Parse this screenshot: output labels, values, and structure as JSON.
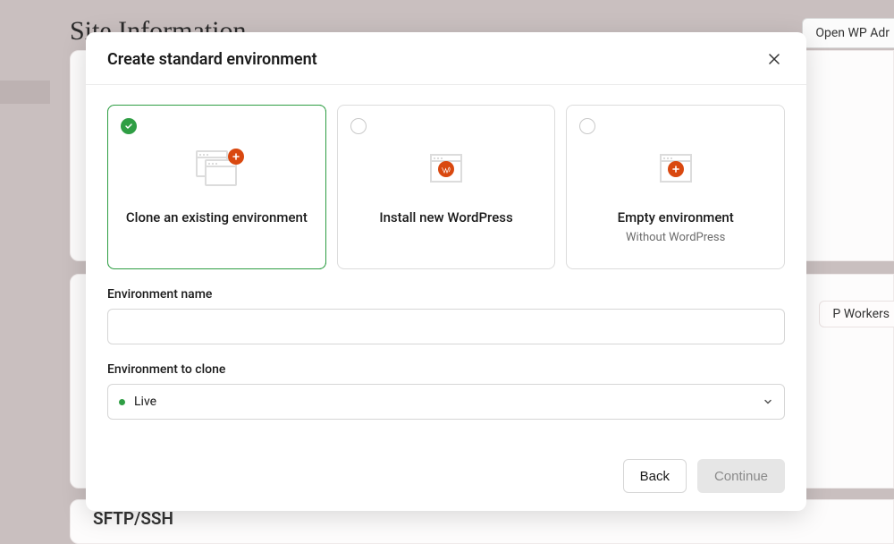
{
  "background": {
    "page_title": "Site Information",
    "wp_admin_button": "Open WP Adr",
    "workers_pill": "P Workers",
    "sftp_title": "SFTP/SSH"
  },
  "modal": {
    "title": "Create standard environment",
    "options": {
      "clone": {
        "title": "Clone an existing environment"
      },
      "install": {
        "title": "Install new WordPress"
      },
      "empty": {
        "title": "Empty environment",
        "subtitle": "Without WordPress"
      }
    },
    "env_name_label": "Environment name",
    "env_name_value": "",
    "env_clone_label": "Environment to clone",
    "env_clone_selected": "Live",
    "footer": {
      "back": "Back",
      "continue": "Continue"
    }
  }
}
